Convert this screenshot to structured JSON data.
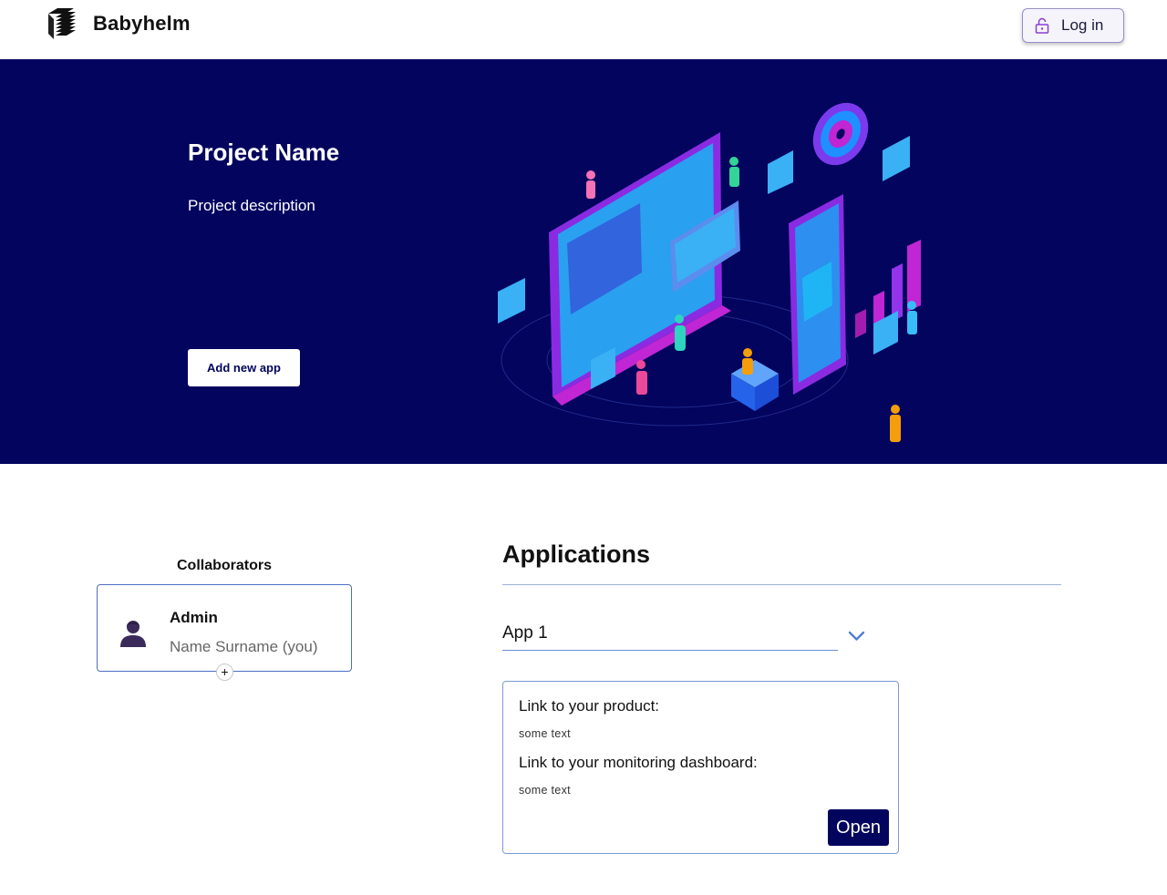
{
  "header": {
    "brand_name": "Babyhelm",
    "login_label": "Log in"
  },
  "hero": {
    "title": "Project Name",
    "description": "Project description",
    "add_app_label": "Add new app"
  },
  "collaborators": {
    "title": "Collaborators",
    "items": [
      {
        "role": "Admin",
        "name": "Name Surname (you)"
      }
    ],
    "add_label": "+"
  },
  "applications": {
    "title": "Applications",
    "selected_app": "App 1",
    "card": {
      "product_label": "Link to your product:",
      "product_value": "some text",
      "dashboard_label": "Link to your monitoring dashboard:",
      "dashboard_value": "some text",
      "open_label": "Open"
    }
  },
  "colors": {
    "hero_bg": "#03045e",
    "accent_border": "#4a6fc4",
    "button_dark": "#03045e"
  },
  "icons": [
    "babyhelm-logo-icon",
    "lock-icon",
    "person-icon",
    "chevron-down-icon"
  ]
}
